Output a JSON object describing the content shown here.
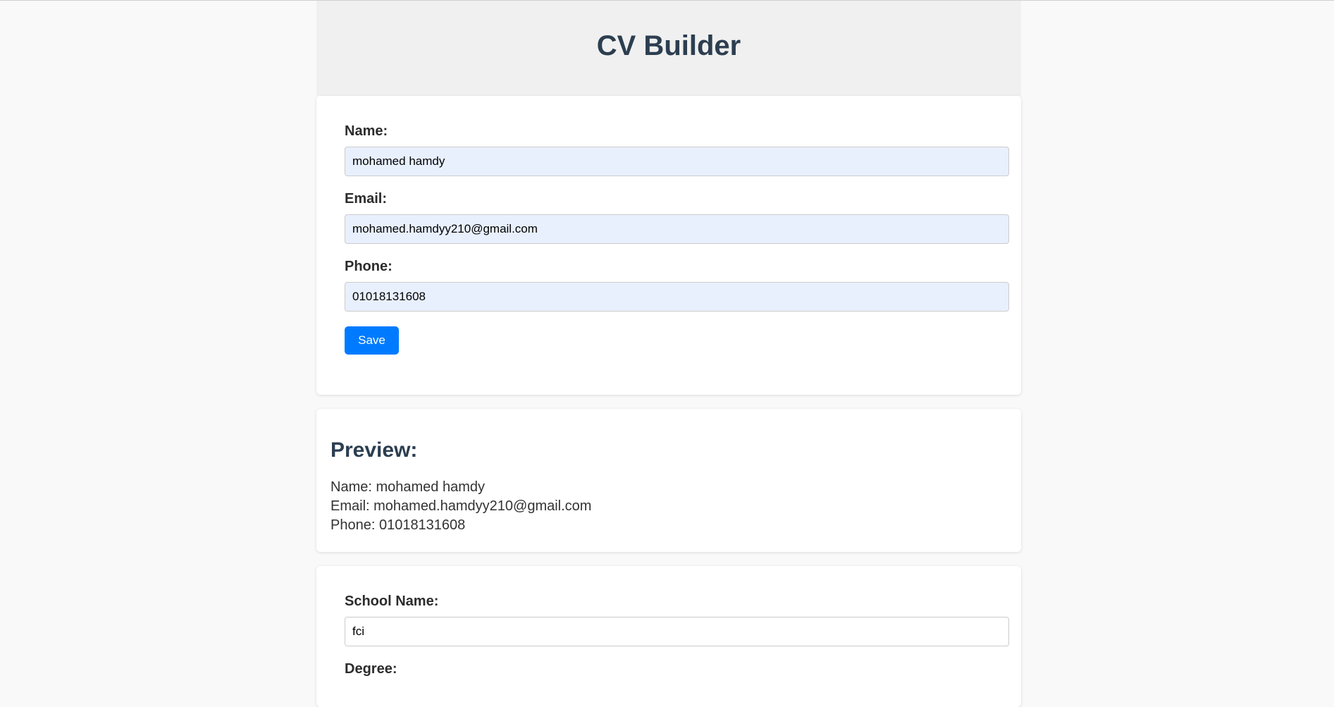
{
  "header": {
    "title": "CV Builder"
  },
  "personal": {
    "name_label": "Name:",
    "name_value": "mohamed hamdy",
    "email_label": "Email:",
    "email_value": "mohamed.hamdyy210@gmail.com",
    "phone_label": "Phone:",
    "phone_value": "01018131608",
    "save_label": "Save"
  },
  "preview": {
    "title": "Preview:",
    "name_line": "Name: mohamed hamdy",
    "email_line": "Email: mohamed.hamdyy210@gmail.com",
    "phone_line": "Phone: 01018131608"
  },
  "education": {
    "school_label": "School Name:",
    "school_value": "fci",
    "degree_label": "Degree:"
  },
  "colors": {
    "accent": "#007bff",
    "heading": "#2c3e50",
    "autofill_bg": "#e8f0fe"
  }
}
